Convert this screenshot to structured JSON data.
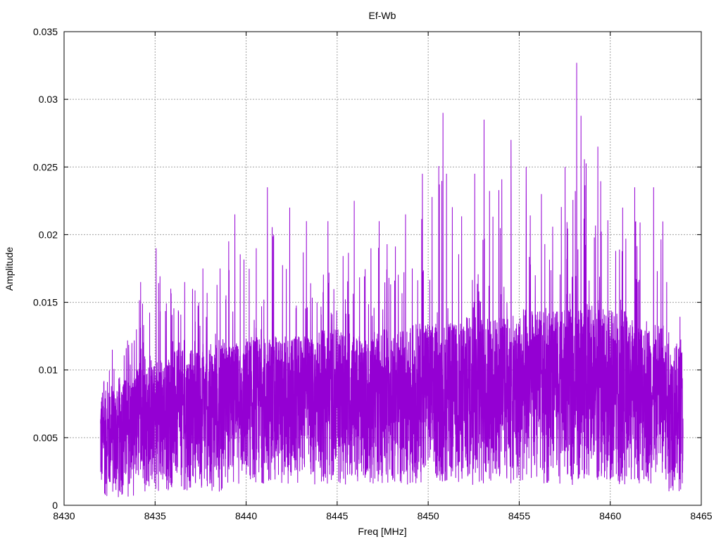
{
  "chart_data": {
    "type": "line",
    "title": "Ef-Wb",
    "xlabel": "Freq [MHz]",
    "ylabel": "Amplitude",
    "xlim": [
      8430,
      8465
    ],
    "ylim": [
      0,
      0.035
    ],
    "xticks": [
      8430,
      8435,
      8440,
      8445,
      8450,
      8455,
      8460,
      8465
    ],
    "xtick_labels": [
      "8430",
      "8435",
      "8440",
      "8445",
      "8450",
      "8455",
      "8460",
      "8465"
    ],
    "yticks": [
      0,
      0.005,
      0.01,
      0.015,
      0.02,
      0.025,
      0.03,
      0.035
    ],
    "ytick_labels": [
      "0",
      "0.005",
      "0.01",
      "0.015",
      "0.02",
      "0.025",
      "0.03",
      "0.035"
    ],
    "grid": true,
    "legend": "none",
    "series": [
      {
        "name": "Ef-Wb",
        "color": "#9400d3",
        "note": "dense noisy spectrum summarized per 1 MHz bin",
        "bin_start": [
          8432,
          8433,
          8434,
          8435,
          8436,
          8437,
          8438,
          8439,
          8440,
          8441,
          8442,
          8443,
          8444,
          8445,
          8446,
          8447,
          8448,
          8449,
          8450,
          8451,
          8452,
          8453,
          8454,
          8455,
          8456,
          8457,
          8458,
          8459,
          8460,
          8461,
          8462,
          8463
        ],
        "peak": [
          0.0115,
          0.013,
          0.0165,
          0.019,
          0.0165,
          0.0175,
          0.0175,
          0.0215,
          0.019,
          0.0235,
          0.022,
          0.021,
          0.021,
          0.0225,
          0.019,
          0.021,
          0.0215,
          0.0245,
          0.029,
          0.0245,
          0.0245,
          0.0285,
          0.027,
          0.025,
          0.023,
          0.025,
          0.0327,
          0.0265,
          0.022,
          0.0235,
          0.0235,
          0.0165
        ],
        "typical_max": [
          0.0085,
          0.0095,
          0.0105,
          0.011,
          0.0115,
          0.0115,
          0.012,
          0.012,
          0.0125,
          0.0125,
          0.0125,
          0.0125,
          0.013,
          0.013,
          0.0125,
          0.013,
          0.013,
          0.0135,
          0.0135,
          0.0135,
          0.014,
          0.014,
          0.014,
          0.0145,
          0.0145,
          0.0145,
          0.015,
          0.0145,
          0.0145,
          0.014,
          0.0135,
          0.012
        ],
        "floor": [
          0.0005,
          0.0005,
          0.001,
          0.001,
          0.001,
          0.001,
          0.001,
          0.0015,
          0.0015,
          0.0015,
          0.0015,
          0.0015,
          0.0015,
          0.0015,
          0.0015,
          0.0015,
          0.0015,
          0.0015,
          0.0015,
          0.0015,
          0.0015,
          0.0015,
          0.0015,
          0.0015,
          0.0015,
          0.0015,
          0.0015,
          0.0015,
          0.0015,
          0.0015,
          0.0015,
          0.001
        ],
        "x_end": 8464,
        "end_value": 0.005
      }
    ]
  }
}
